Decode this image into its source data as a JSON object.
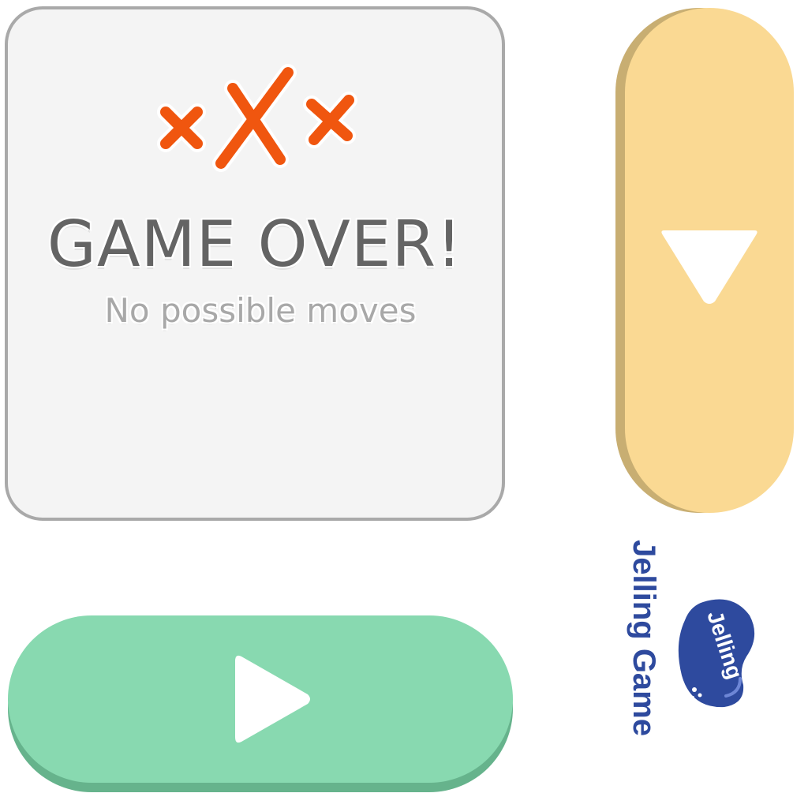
{
  "game_over": {
    "title": "GAME OVER!",
    "subtitle": "No possible moves",
    "lives_lost_icon": "x-marks-icon"
  },
  "controls": {
    "play_icon": "play-triangle-icon",
    "down_icon": "down-triangle-icon"
  },
  "brand": {
    "name": "Jelling Game",
    "logo_text": "Jelling"
  },
  "colors": {
    "panel_bg": "#f4f4f4",
    "panel_border": "#a9a9a9",
    "title_text": "#646464",
    "subtitle_text": "#a8a8a8",
    "cross": "#f0560f",
    "play_button": "#88d9b0",
    "play_button_shadow": "#66b38c",
    "down_button": "#fad993",
    "down_button_shadow": "#c8ae72",
    "brand_blue": "#2e4a9e"
  }
}
